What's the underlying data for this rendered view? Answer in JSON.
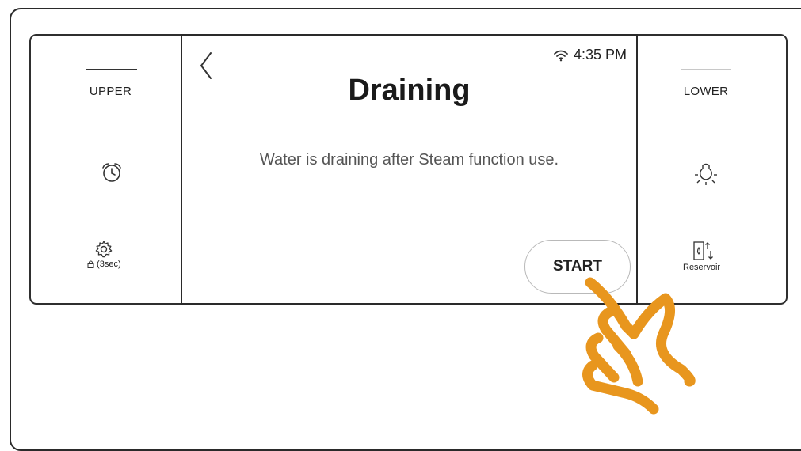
{
  "left_panel": {
    "tab_label": "UPPER",
    "timer_icon": "alarm-clock-icon",
    "settings_icon": "gear-icon",
    "settings_sub_label": " (3sec)",
    "lock_icon": "lock-icon"
  },
  "screen": {
    "back_icon": "chevron-left-icon",
    "wifi_icon": "wifi-icon",
    "time": "4:35 PM",
    "title": "Draining",
    "message": "Water is draining after Steam function use.",
    "start_label": "START"
  },
  "right_panel": {
    "tab_label": "LOWER",
    "light_icon": "light-bulb-icon",
    "reservoir_icon": "reservoir-icon",
    "reservoir_label": "Reservoir"
  },
  "illustration": {
    "hand_icon": "pointing-hand-icon"
  },
  "colors": {
    "accent_hand": "#E8961E",
    "border": "#2a2a2a",
    "text_secondary": "#555555"
  }
}
